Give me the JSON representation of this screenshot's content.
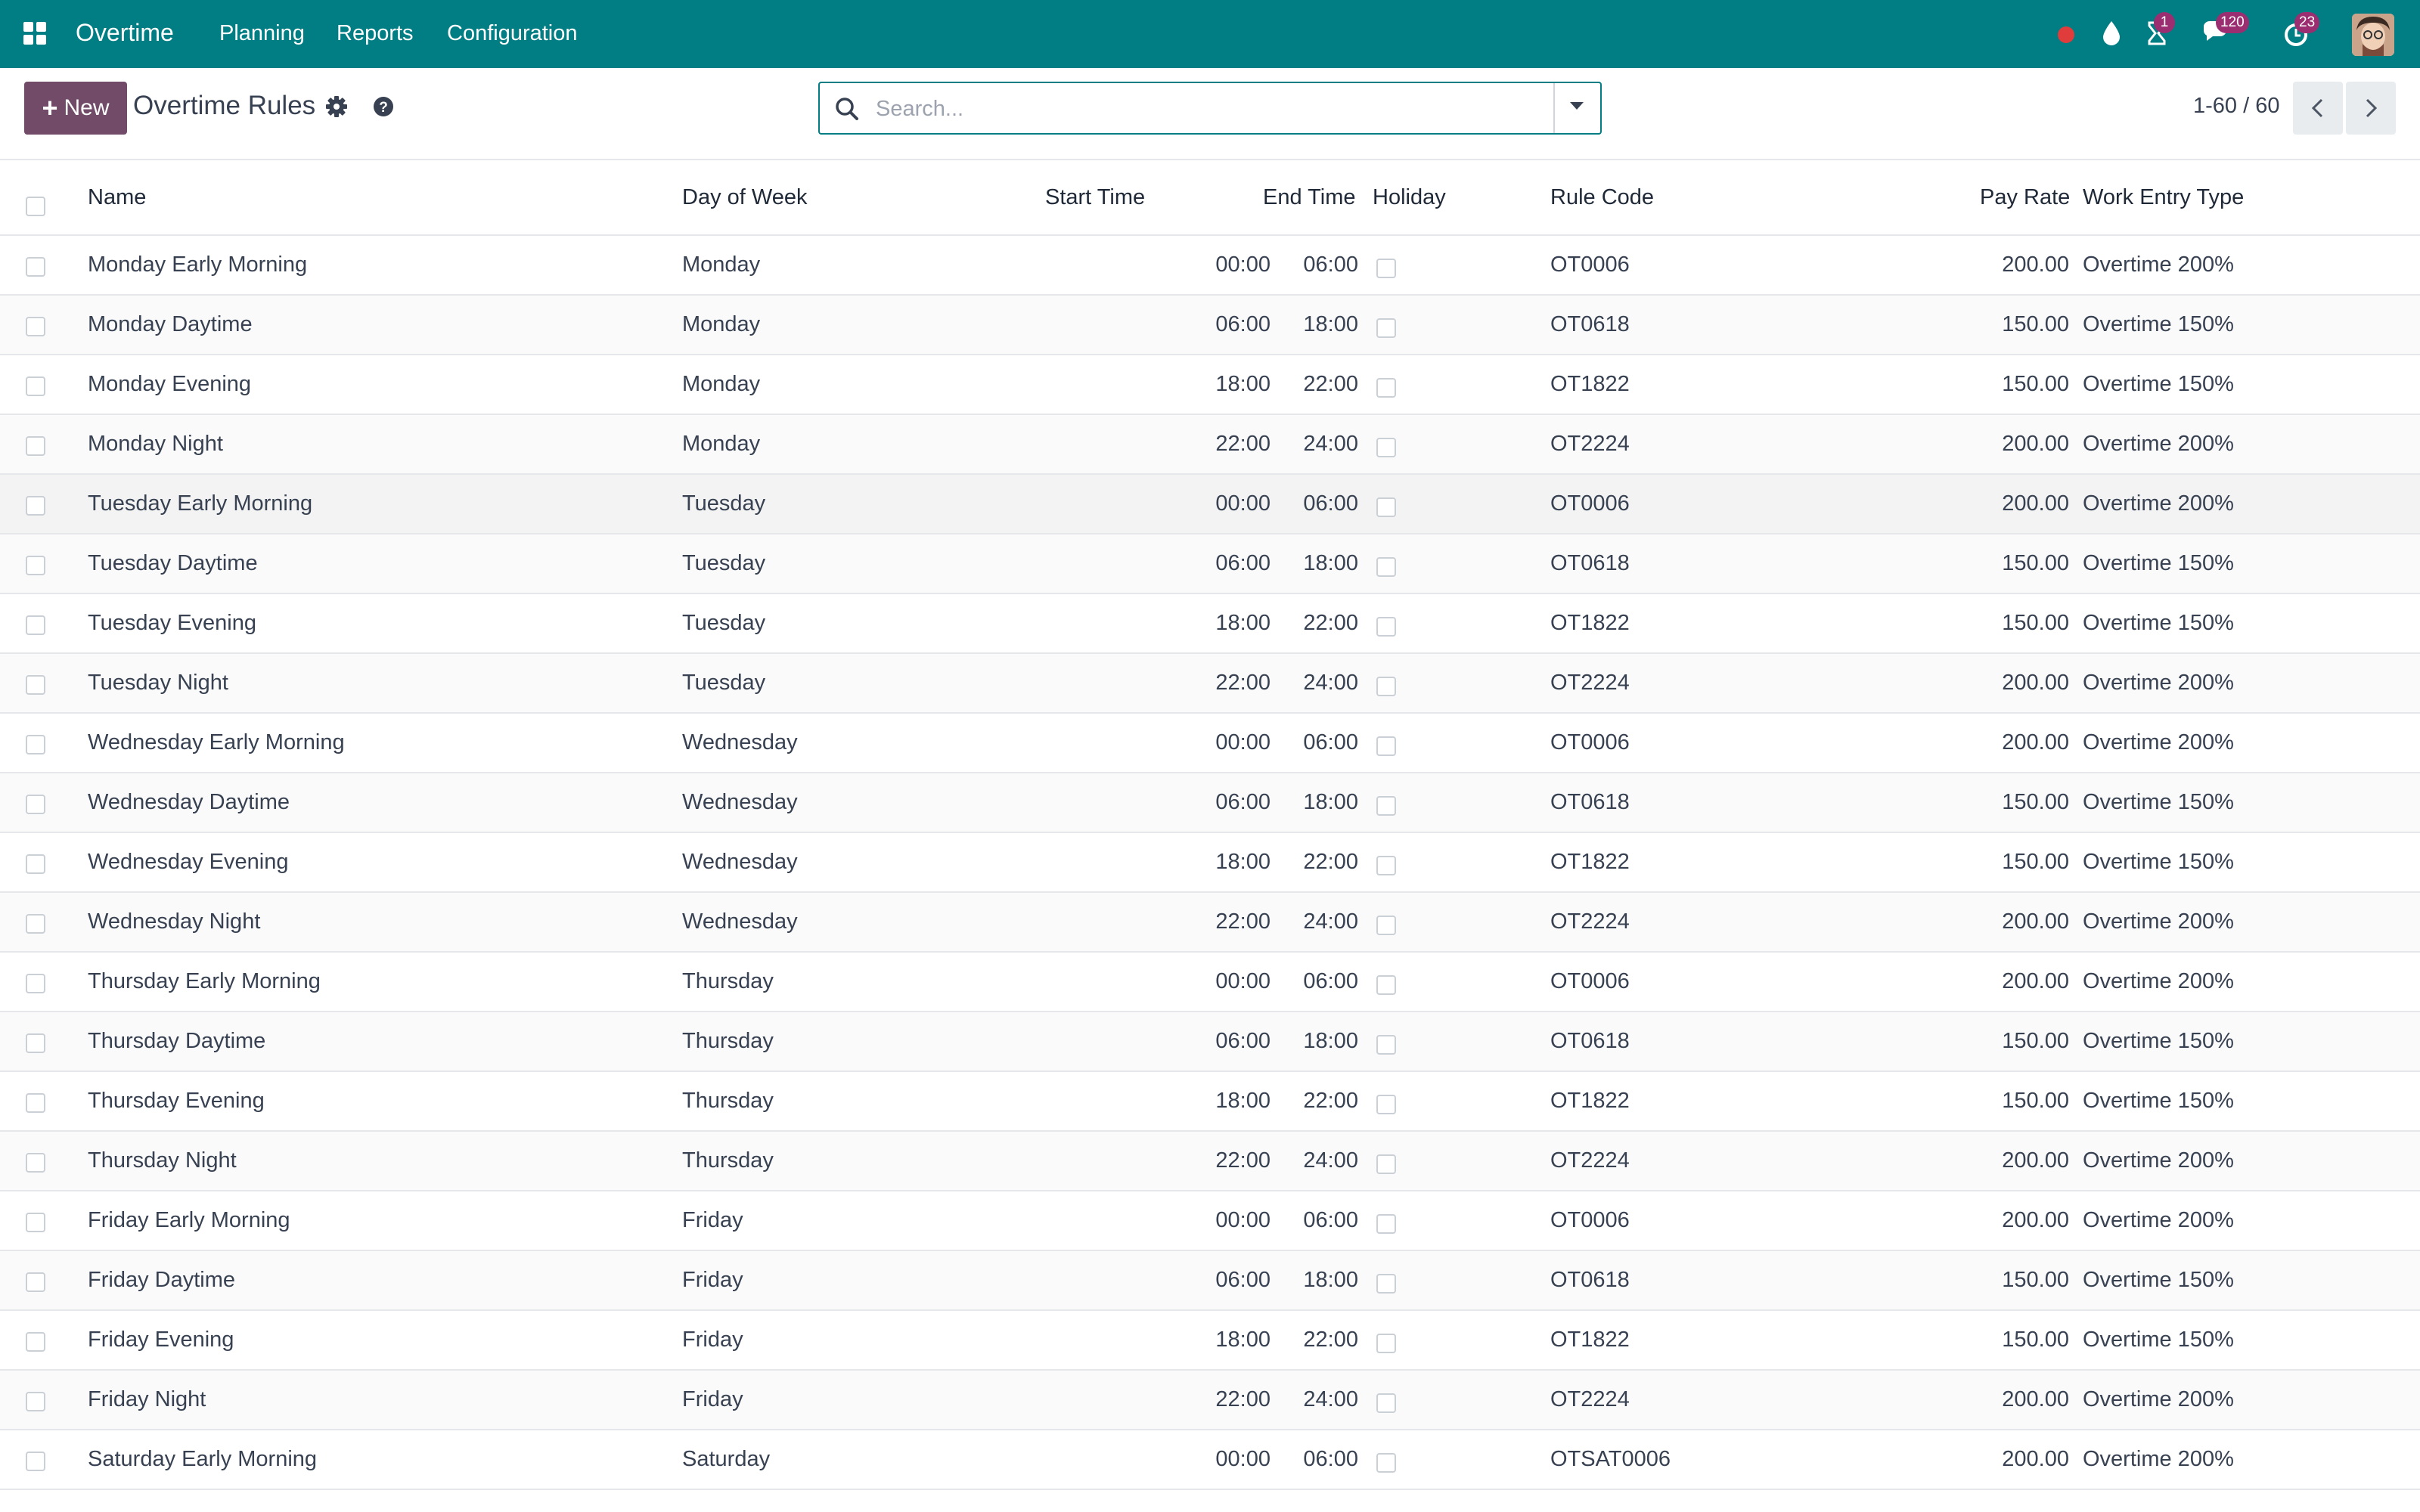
{
  "navbar": {
    "app_name": "Overtime",
    "menu": [
      "Planning",
      "Reports",
      "Configuration"
    ],
    "systray": {
      "activity_badge": "1",
      "messages_badge": "120",
      "updates_badge": "23"
    }
  },
  "control_panel": {
    "new_label": "New",
    "title": "Overtime Rules",
    "search_placeholder": "Search...",
    "pager": "1-60 / 60"
  },
  "table": {
    "headers": {
      "name": "Name",
      "day": "Day of Week",
      "start": "Start Time",
      "end": "End Time",
      "holiday": "Holiday",
      "code": "Rule Code",
      "rate": "Pay Rate",
      "type": "Work Entry Type"
    },
    "rows": [
      {
        "name": "Monday Early Morning",
        "day": "Monday",
        "start": "00:00",
        "end": "06:00",
        "holiday": false,
        "code": "OT0006",
        "rate": "200.00",
        "type": "Overtime 200%"
      },
      {
        "name": "Monday Daytime",
        "day": "Monday",
        "start": "06:00",
        "end": "18:00",
        "holiday": false,
        "code": "OT0618",
        "rate": "150.00",
        "type": "Overtime 150%"
      },
      {
        "name": "Monday Evening",
        "day": "Monday",
        "start": "18:00",
        "end": "22:00",
        "holiday": false,
        "code": "OT1822",
        "rate": "150.00",
        "type": "Overtime 150%"
      },
      {
        "name": "Monday Night",
        "day": "Monday",
        "start": "22:00",
        "end": "24:00",
        "holiday": false,
        "code": "OT2224",
        "rate": "200.00",
        "type": "Overtime 200%"
      },
      {
        "name": "Tuesday Early Morning",
        "day": "Tuesday",
        "start": "00:00",
        "end": "06:00",
        "holiday": false,
        "code": "OT0006",
        "rate": "200.00",
        "type": "Overtime 200%"
      },
      {
        "name": "Tuesday Daytime",
        "day": "Tuesday",
        "start": "06:00",
        "end": "18:00",
        "holiday": false,
        "code": "OT0618",
        "rate": "150.00",
        "type": "Overtime 150%"
      },
      {
        "name": "Tuesday Evening",
        "day": "Tuesday",
        "start": "18:00",
        "end": "22:00",
        "holiday": false,
        "code": "OT1822",
        "rate": "150.00",
        "type": "Overtime 150%"
      },
      {
        "name": "Tuesday Night",
        "day": "Tuesday",
        "start": "22:00",
        "end": "24:00",
        "holiday": false,
        "code": "OT2224",
        "rate": "200.00",
        "type": "Overtime 200%"
      },
      {
        "name": "Wednesday Early Morning",
        "day": "Wednesday",
        "start": "00:00",
        "end": "06:00",
        "holiday": false,
        "code": "OT0006",
        "rate": "200.00",
        "type": "Overtime 200%"
      },
      {
        "name": "Wednesday Daytime",
        "day": "Wednesday",
        "start": "06:00",
        "end": "18:00",
        "holiday": false,
        "code": "OT0618",
        "rate": "150.00",
        "type": "Overtime 150%"
      },
      {
        "name": "Wednesday Evening",
        "day": "Wednesday",
        "start": "18:00",
        "end": "22:00",
        "holiday": false,
        "code": "OT1822",
        "rate": "150.00",
        "type": "Overtime 150%"
      },
      {
        "name": "Wednesday Night",
        "day": "Wednesday",
        "start": "22:00",
        "end": "24:00",
        "holiday": false,
        "code": "OT2224",
        "rate": "200.00",
        "type": "Overtime 200%"
      },
      {
        "name": "Thursday Early Morning",
        "day": "Thursday",
        "start": "00:00",
        "end": "06:00",
        "holiday": false,
        "code": "OT0006",
        "rate": "200.00",
        "type": "Overtime 200%"
      },
      {
        "name": "Thursday Daytime",
        "day": "Thursday",
        "start": "06:00",
        "end": "18:00",
        "holiday": false,
        "code": "OT0618",
        "rate": "150.00",
        "type": "Overtime 150%"
      },
      {
        "name": "Thursday Evening",
        "day": "Thursday",
        "start": "18:00",
        "end": "22:00",
        "holiday": false,
        "code": "OT1822",
        "rate": "150.00",
        "type": "Overtime 150%"
      },
      {
        "name": "Thursday Night",
        "day": "Thursday",
        "start": "22:00",
        "end": "24:00",
        "holiday": false,
        "code": "OT2224",
        "rate": "200.00",
        "type": "Overtime 200%"
      },
      {
        "name": "Friday Early Morning",
        "day": "Friday",
        "start": "00:00",
        "end": "06:00",
        "holiday": false,
        "code": "OT0006",
        "rate": "200.00",
        "type": "Overtime 200%"
      },
      {
        "name": "Friday Daytime",
        "day": "Friday",
        "start": "06:00",
        "end": "18:00",
        "holiday": false,
        "code": "OT0618",
        "rate": "150.00",
        "type": "Overtime 150%"
      },
      {
        "name": "Friday Evening",
        "day": "Friday",
        "start": "18:00",
        "end": "22:00",
        "holiday": false,
        "code": "OT1822",
        "rate": "150.00",
        "type": "Overtime 150%"
      },
      {
        "name": "Friday Night",
        "day": "Friday",
        "start": "22:00",
        "end": "24:00",
        "holiday": false,
        "code": "OT2224",
        "rate": "200.00",
        "type": "Overtime 200%"
      },
      {
        "name": "Saturday Early Morning",
        "day": "Saturday",
        "start": "00:00",
        "end": "06:00",
        "holiday": false,
        "code": "OTSAT0006",
        "rate": "200.00",
        "type": "Overtime 200%"
      }
    ]
  },
  "colors": {
    "navbar": "#017e84",
    "primary_button": "#714b67",
    "badge": "#9b2e70",
    "recording_dot": "#e03c3c"
  },
  "icons": {
    "apps": "apps-grid-icon",
    "record": "record-dot-icon",
    "drop": "water-drop-icon",
    "activity": "hourglass-icon",
    "messages": "chat-bubbles-icon",
    "updates": "clock-refresh-icon",
    "settings": "gear-icon",
    "help": "question-circle-icon",
    "search": "search-icon",
    "toggle": "caret-down-icon",
    "prev": "chevron-left-icon",
    "next": "chevron-right-icon"
  }
}
